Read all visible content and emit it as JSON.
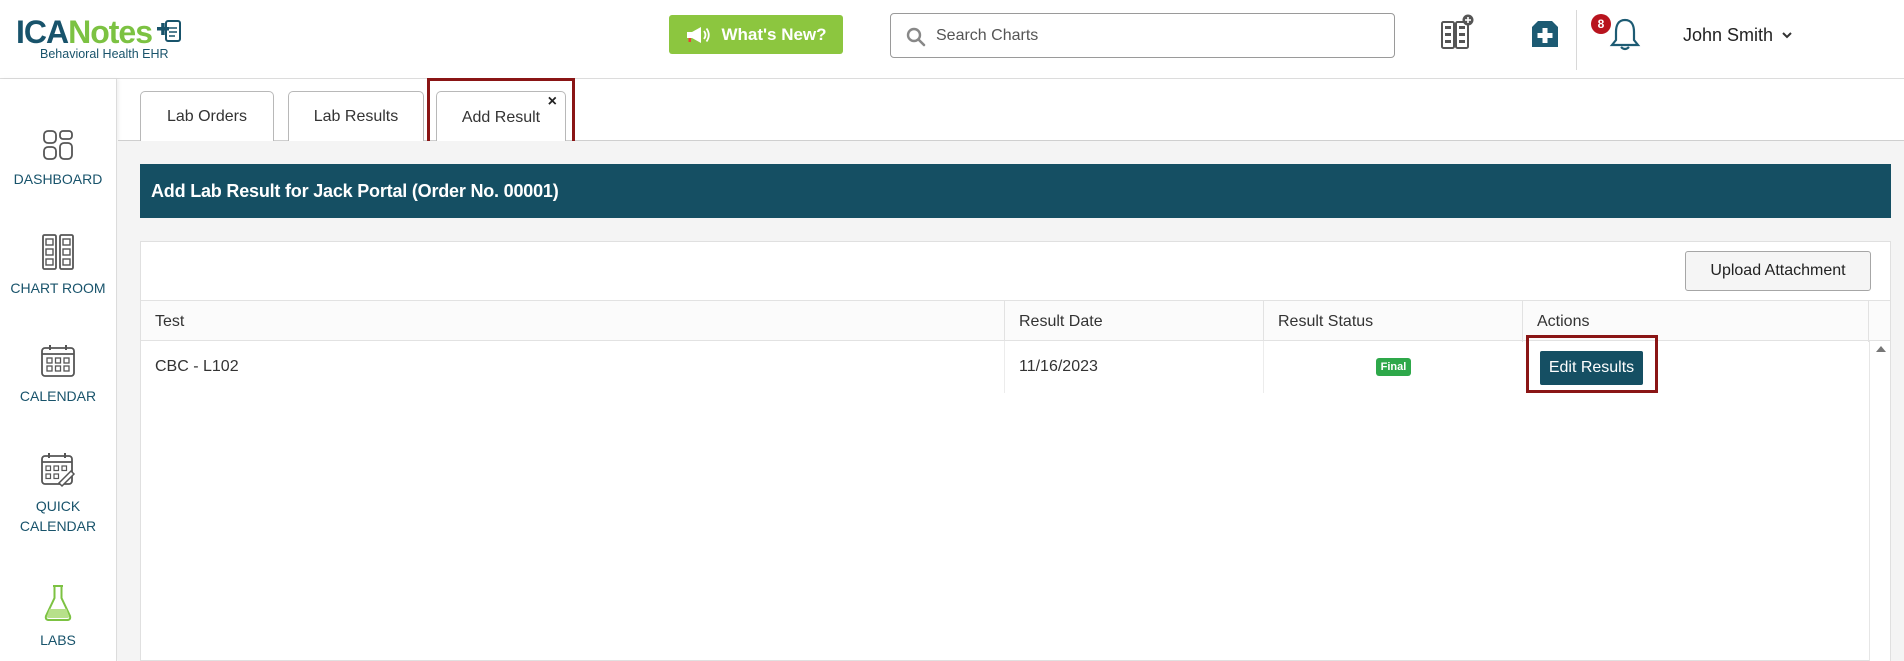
{
  "header": {
    "logo_main_a": "ICA",
    "logo_main_b": "Notes",
    "logo_sub": "Behavioral Health EHR",
    "whats_new_label": "What's New?",
    "search_placeholder": "Search Charts",
    "notification_count": "8",
    "user_name": "John Smith"
  },
  "sidebar": {
    "items": [
      {
        "label": "DASHBOARD"
      },
      {
        "label": "CHART ROOM"
      },
      {
        "label": "CALENDAR"
      },
      {
        "label": "QUICK CALENDAR"
      },
      {
        "label": "LABS"
      }
    ]
  },
  "tabs": [
    {
      "label": "Lab Orders"
    },
    {
      "label": "Lab Results"
    },
    {
      "label": "Add Result",
      "close": "×"
    }
  ],
  "main": {
    "section_title": "Add Lab Result for Jack Portal (Order No. 00001)",
    "upload_label": "Upload Attachment",
    "table": {
      "columns": [
        "Test",
        "Result Date",
        "Result Status",
        "Actions"
      ],
      "rows": [
        {
          "test": "CBC - L102",
          "result_date": "11/16/2023",
          "status": "Final",
          "action": "Edit Results"
        }
      ]
    }
  },
  "colors": {
    "brand_dark": "#154f63",
    "brand_green": "#7cc242",
    "whats_new_bg": "#8cc63f",
    "badge_final": "#2ea84a",
    "notification_badge": "#b8141e",
    "highlight_outline": "#8a1515"
  },
  "icons": {
    "whats_new": "megaphone-icon",
    "search": "search-icon",
    "chart_add": "chart-add-icon",
    "rx": "prescription-icon",
    "bell": "bell-icon",
    "user_menu": "chevron-down-icon",
    "dashboard": "dashboard-icon",
    "chart_room": "chart-room-icon",
    "calendar": "calendar-icon",
    "quick_calendar": "quick-calendar-icon",
    "labs": "flask-icon"
  }
}
